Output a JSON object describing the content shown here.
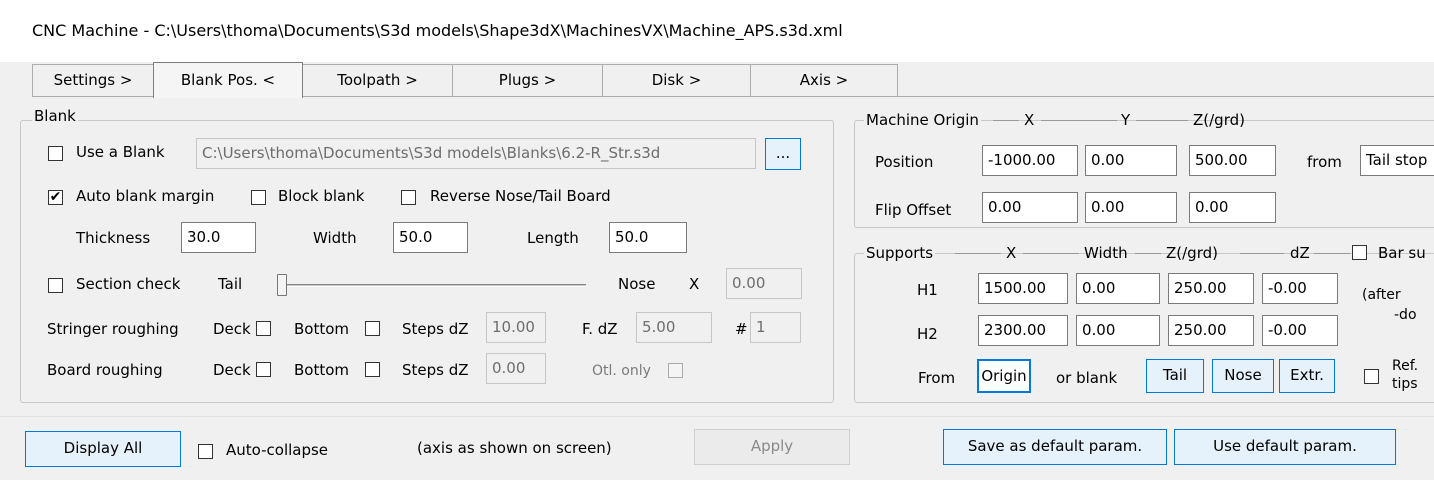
{
  "window": {
    "title": "CNC Machine - C:\\Users\\thoma\\Documents\\S3d models\\Shape3dX\\MachinesVX\\Machine_APS.s3d.xml"
  },
  "tabs": [
    {
      "label": "Settings >"
    },
    {
      "label": "Blank Pos. <",
      "active": true
    },
    {
      "label": "Toolpath >"
    },
    {
      "label": "Plugs >"
    },
    {
      "label": "Disk >"
    },
    {
      "label": "Axis >"
    }
  ],
  "blank": {
    "group_label": "Blank",
    "use_blank_label": "Use a Blank",
    "use_blank_checked": "",
    "blank_path": "C:\\Users\\thoma\\Documents\\S3d models\\Blanks\\6.2-R_Str.s3d",
    "browse_label": "...",
    "auto_margin_label": "Auto blank margin",
    "auto_margin_checked": "✔",
    "block_blank_label": "Block blank",
    "block_blank_checked": "",
    "reverse_label": "Reverse Nose/Tail Board",
    "reverse_checked": "",
    "thickness_label": "Thickness",
    "thickness_value": "30.0",
    "width_label": "Width",
    "width_value": "50.0",
    "length_label": "Length",
    "length_value": "50.0",
    "section_check_label": "Section check",
    "section_check_checked": "",
    "tail_label": "Tail",
    "nose_label": "Nose",
    "slider_position": 0,
    "x_label": "X",
    "x_value": "0.00",
    "stringer_label": "Stringer roughing",
    "deck_label": "Deck",
    "bottom_label": "Bottom",
    "steps_dz_label": "Steps dZ",
    "stringer_steps_dz": "10.00",
    "fdz_label": "F. dZ",
    "fdz_value": "5.00",
    "hash_label": "#",
    "hash_value": "1",
    "board_label": "Board roughing",
    "board_steps_dz": "0.00",
    "otl_only_label": "Otl. only"
  },
  "origin": {
    "group_label": "Machine Origin",
    "col_x": "X",
    "col_y": "Y",
    "col_z": "Z(/grd)",
    "position_label": "Position",
    "pos_x": "-1000.00",
    "pos_y": "0.00",
    "pos_z": "500.00",
    "from_label": "from",
    "from_value": "Tail stop",
    "flip_label": "Flip Offset",
    "flip_x": "0.00",
    "flip_y": "0.00",
    "flip_z": "0.00"
  },
  "supports": {
    "group_label": "Supports",
    "col_x": "X",
    "col_width": "Width",
    "col_z": "Z(/grd)",
    "col_dz": "dZ",
    "bar_label": "Bar su",
    "h1_label": "H1",
    "h1_x": "1500.00",
    "h1_width": "0.00",
    "h1_z": "250.00",
    "h1_dz": "-0.00",
    "h2_label": "H2",
    "h2_x": "2300.00",
    "h2_width": "0.00",
    "h2_z": "250.00",
    "h2_dz": "-0.00",
    "after_line1": "(after",
    "after_line2": "-do",
    "from_label": "From",
    "origin_btn": "Origin",
    "or_blank": "or blank",
    "tail_btn": "Tail",
    "nose_btn": "Nose",
    "extr_btn": "Extr.",
    "ref_line1": "Ref.",
    "ref_line2": "tips"
  },
  "footer": {
    "display_all": "Display All",
    "auto_collapse_label": "Auto-collapse",
    "axis_note": "(axis as shown on screen)",
    "apply": "Apply",
    "save_default": "Save as default param.",
    "use_default": "Use default param."
  }
}
